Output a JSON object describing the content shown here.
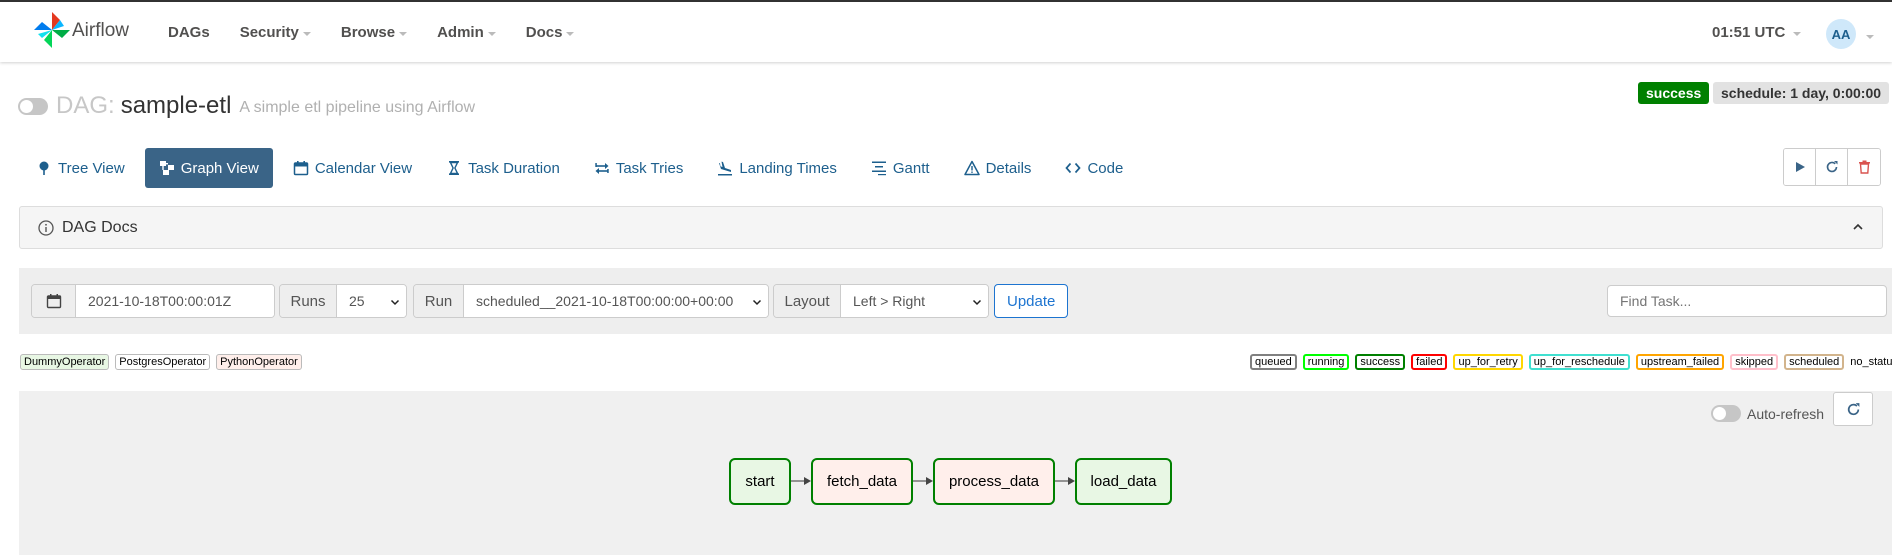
{
  "navbar": {
    "brand": "Airflow",
    "menu": [
      {
        "label": "DAGs",
        "has_caret": false
      },
      {
        "label": "Security",
        "has_caret": true
      },
      {
        "label": "Browse",
        "has_caret": true
      },
      {
        "label": "Admin",
        "has_caret": true
      },
      {
        "label": "Docs",
        "has_caret": true
      }
    ],
    "clock": "01:51 UTC",
    "user_initials": "AA"
  },
  "dag": {
    "prefix": "DAG:",
    "id": "sample-etl",
    "description": "A simple etl pipeline using Airflow",
    "status": "success",
    "schedule": "schedule: 1 day, 0:00:00"
  },
  "tabs": [
    {
      "label": "Tree View",
      "icon": "tree-icon",
      "active": false
    },
    {
      "label": "Graph View",
      "icon": "graph-icon",
      "active": true
    },
    {
      "label": "Calendar View",
      "icon": "calendar-icon",
      "active": false
    },
    {
      "label": "Task Duration",
      "icon": "hourglass-icon",
      "active": false
    },
    {
      "label": "Task Tries",
      "icon": "retry-icon",
      "active": false
    },
    {
      "label": "Landing Times",
      "icon": "landing-icon",
      "active": false
    },
    {
      "label": "Gantt",
      "icon": "gantt-icon",
      "active": false
    },
    {
      "label": "Details",
      "icon": "warning-icon",
      "active": false
    },
    {
      "label": "Code",
      "icon": "code-icon",
      "active": false
    }
  ],
  "docs_panel": {
    "title": "DAG Docs"
  },
  "filters": {
    "base_date": "2021-10-18T00:00:01Z",
    "runs_label": "Runs",
    "runs_value": "25",
    "run_label": "Run",
    "run_value": "scheduled__2021-10-18T00:00:00+00:00",
    "layout_label": "Layout",
    "layout_value": "Left > Right",
    "update_label": "Update",
    "find_task_placeholder": "Find Task..."
  },
  "operators": [
    {
      "label": "DummyOperator",
      "color": "#e8f7e4"
    },
    {
      "label": "PostgresOperator",
      "color": "#ffffff"
    },
    {
      "label": "PythonOperator",
      "color": "#ffefeb"
    }
  ],
  "states": [
    {
      "label": "queued",
      "color": "#808080"
    },
    {
      "label": "running",
      "color": "#00ff00"
    },
    {
      "label": "success",
      "color": "#008000"
    },
    {
      "label": "failed",
      "color": "#ff0000"
    },
    {
      "label": "up_for_retry",
      "color": "#ffd700"
    },
    {
      "label": "up_for_reschedule",
      "color": "#40e0d0"
    },
    {
      "label": "upstream_failed",
      "color": "#ffa500"
    },
    {
      "label": "skipped",
      "color": "#ffc0cb"
    },
    {
      "label": "scheduled",
      "color": "#d2b48c"
    },
    {
      "label": "no_status",
      "color": null
    }
  ],
  "graph": {
    "auto_refresh_label": "Auto-refresh",
    "nodes": [
      {
        "label": "start",
        "fill": "#e8f7e4",
        "border": "#008000"
      },
      {
        "label": "fetch_data",
        "fill": "#ffefeb",
        "border": "#008000"
      },
      {
        "label": "process_data",
        "fill": "#ffefeb",
        "border": "#008000"
      },
      {
        "label": "load_data",
        "fill": "#e8f7e4",
        "border": "#008000"
      }
    ]
  }
}
